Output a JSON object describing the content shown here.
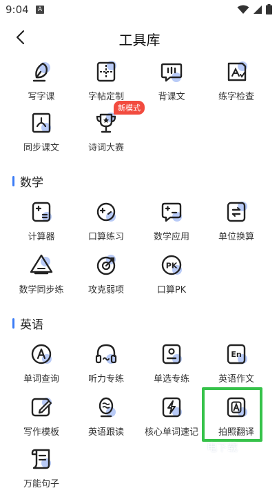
{
  "status": {
    "time": "9:04",
    "notif": "A"
  },
  "header": {
    "title": "工具库"
  },
  "sections": {
    "chinese": {
      "items": [
        {
          "label": "写字课",
          "icon": "pen-nib-icon"
        },
        {
          "label": "字帖定制",
          "icon": "grid-paper-icon"
        },
        {
          "label": "背课文",
          "icon": "chat-bubble-icon"
        },
        {
          "label": "练字检查",
          "icon": "paper-check-icon"
        },
        {
          "label": "同步课文",
          "icon": "book-icon"
        },
        {
          "label": "诗词大赛",
          "icon": "trophy-icon"
        }
      ],
      "badge": "新模式"
    },
    "math": {
      "title": "数学",
      "items": [
        {
          "label": "计算器",
          "icon": "calculator-icon"
        },
        {
          "label": "口算练习",
          "icon": "gamepad-icon"
        },
        {
          "label": "数学应用",
          "icon": "chat-math-icon"
        },
        {
          "label": "单位换算",
          "icon": "equal-icon"
        },
        {
          "label": "数学同步练",
          "icon": "triangle-icon"
        },
        {
          "label": "攻克弱项",
          "icon": "target-icon"
        },
        {
          "label": "口算PK",
          "icon": "pk-icon"
        }
      ]
    },
    "english": {
      "title": "英语",
      "items": [
        {
          "label": "单词查询",
          "icon": "letter-a-icon"
        },
        {
          "label": "听力专练",
          "icon": "headphones-icon"
        },
        {
          "label": "单选专练",
          "icon": "single-choice-icon"
        },
        {
          "label": "英语作文",
          "icon": "en-doc-icon"
        },
        {
          "label": "写作模板",
          "icon": "edit-template-icon"
        },
        {
          "label": "英语跟读",
          "icon": "speaker-icon"
        },
        {
          "label": "核心单词速记",
          "icon": "lightning-icon"
        },
        {
          "label": "拍照翻译",
          "icon": "camera-translate-icon"
        },
        {
          "label": "万能句子",
          "icon": "sentence-doc-icon"
        }
      ]
    }
  },
  "watermark": "电下载",
  "colors": {
    "accent": "#3b7cf6",
    "highlight": "#36c24a",
    "badge": "#f24b3f",
    "icon_shadow": "#b9cbf7"
  }
}
